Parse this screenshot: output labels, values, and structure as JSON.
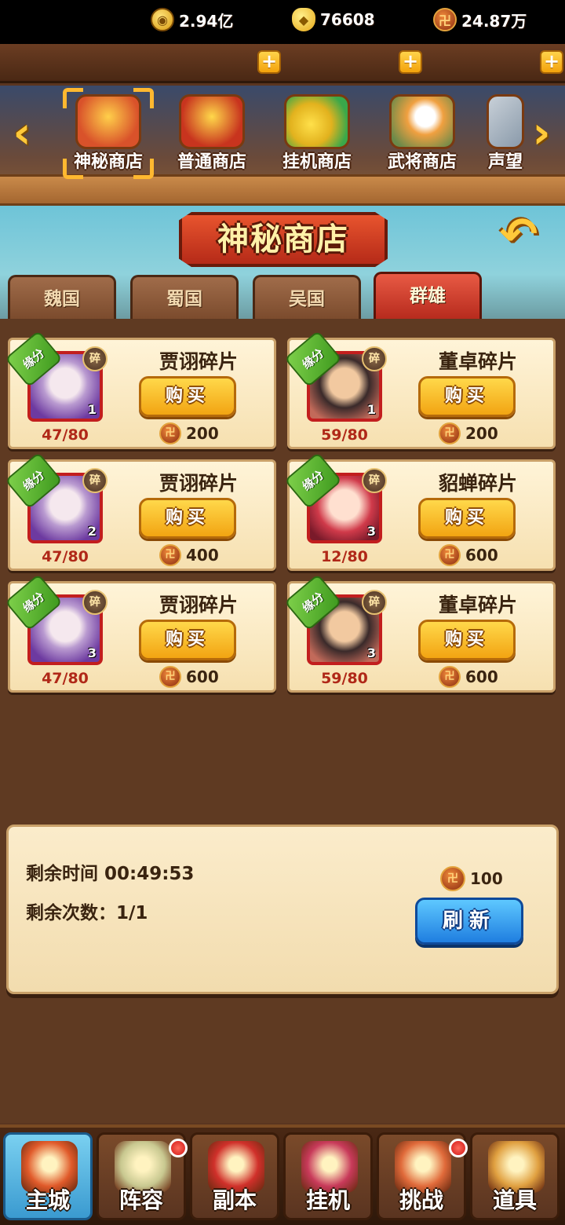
{
  "currency": {
    "coins": "2.94亿",
    "ingots": "76608",
    "tokens": "24.87万",
    "coin_glyph": "◉",
    "ingot_glyph": "◆",
    "token_glyph": "卍",
    "plus_glyph": "+"
  },
  "shop_tabs": [
    {
      "label": "神秘商店",
      "color": "#d9522a"
    },
    {
      "label": "普通商店",
      "color": "#c8341e"
    },
    {
      "label": "挂机商店",
      "color": "#e2b21e"
    },
    {
      "label": "武将商店",
      "color": "#f0a040"
    },
    {
      "label": "声望",
      "color": "#8a9aaa"
    }
  ],
  "nav_arrows": {
    "left": "‹",
    "right": "›"
  },
  "panel": {
    "title": "神秘商店",
    "back_glyph": "↶",
    "factions": [
      "魏国",
      "蜀国",
      "吴国",
      "群雄"
    ],
    "active_faction": "群雄"
  },
  "items": [
    {
      "name": "贾诩碎片",
      "progress": "47/80",
      "price": "200",
      "level": "1",
      "hero": "jia",
      "badge": "缘分",
      "shard": "碎"
    },
    {
      "name": "董卓碎片",
      "progress": "59/80",
      "price": "200",
      "level": "1",
      "hero": "dong",
      "badge": "缘分",
      "shard": "碎"
    },
    {
      "name": "贾诩碎片",
      "progress": "47/80",
      "price": "400",
      "level": "2",
      "hero": "jia",
      "badge": "缘分",
      "shard": "碎"
    },
    {
      "name": "貂蝉碎片",
      "progress": "12/80",
      "price": "600",
      "level": "3",
      "hero": "diao",
      "badge": "缘分",
      "shard": "碎"
    },
    {
      "name": "贾诩碎片",
      "progress": "47/80",
      "price": "600",
      "level": "3",
      "hero": "jia",
      "badge": "缘分",
      "shard": "碎"
    },
    {
      "name": "董卓碎片",
      "progress": "59/80",
      "price": "600",
      "level": "3",
      "hero": "dong",
      "badge": "缘分",
      "shard": "碎"
    }
  ],
  "buy_label": "购买",
  "refresh": {
    "time": "剩余时间 00:49:53",
    "count": "剩余次数：1/1",
    "cost": "100",
    "button": "刷新"
  },
  "bottom_nav": [
    {
      "label": "主城",
      "color": "#e05a2a",
      "dot": false
    },
    {
      "label": "阵容",
      "color": "#c8c890",
      "dot": true
    },
    {
      "label": "副本",
      "color": "#d0302a",
      "dot": false
    },
    {
      "label": "挂机",
      "color": "#c83a5a",
      "dot": false
    },
    {
      "label": "挑战",
      "color": "#e06a3a",
      "dot": true
    },
    {
      "label": "道具",
      "color": "#e0a040",
      "dot": false
    }
  ]
}
